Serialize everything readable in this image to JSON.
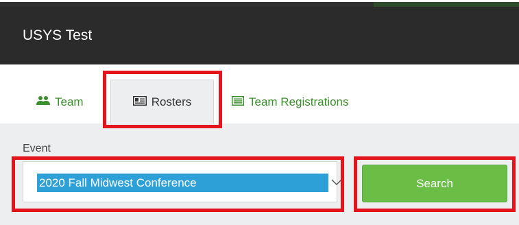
{
  "app": {
    "title": "USYS Test"
  },
  "tabs": [
    {
      "label": "Team",
      "icon": "users-icon"
    },
    {
      "label": "Rosters",
      "icon": "id-card-icon",
      "active": true
    },
    {
      "label": "Team Registrations",
      "icon": "list-icon"
    }
  ],
  "event": {
    "label": "Event",
    "selected": "2020 Fall Midwest Conference"
  },
  "search": {
    "label": "Search"
  },
  "colors": {
    "header_bg": "#2b2b2b",
    "tab_green": "#3b8f2c",
    "search_green": "#6abd45",
    "selection_blue": "#2ea0d8",
    "highlight_red": "#e3141b"
  }
}
